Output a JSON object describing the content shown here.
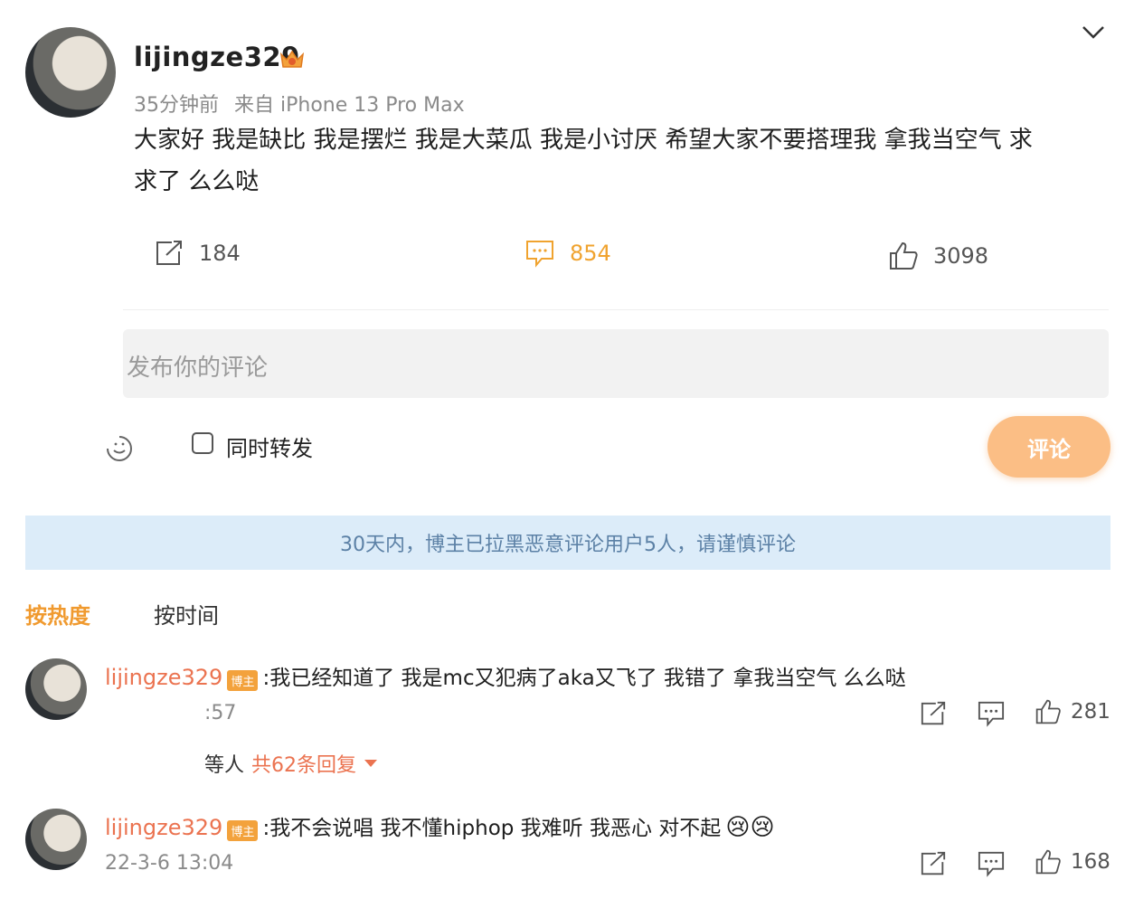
{
  "post": {
    "username": "lijingze329",
    "time": "35分钟前",
    "source": "来自 iPhone 13 Pro Max",
    "text_line1": "大家好 我是缺比 我是摆烂 我是大菜瓜 我是小讨厌 希望大家不要搭理我 拿我当空气 求",
    "text_line2": "求了 么么哒",
    "repost_count": "184",
    "comment_count": "854",
    "like_count": "3098"
  },
  "composer": {
    "placeholder": "发布你的评论",
    "repost_label": "同时转发",
    "submit_label": "评论"
  },
  "notice": "30天内，博主已拉黑恶意评论用户5人，请谨慎评论",
  "sort_tabs": {
    "hot": "按热度",
    "time": "按时间"
  },
  "comments": [
    {
      "username": "lijingze329",
      "badge": "博主",
      "text": ":我已经知道了 我是mc又犯病了aka又飞了 我错了 拿我当空气 么么哒",
      "time": ":57",
      "like_count": "281",
      "reply_prefix": "等人",
      "reply_count": "共62条回复"
    },
    {
      "username": "lijingze329",
      "badge": "博主",
      "text": ":我不会说唱 我不懂hiphop 我难听 我恶心 对不起",
      "emoji": "😢😢",
      "time": "22-3-6 13:04",
      "like_count": "168"
    }
  ],
  "colors": {
    "accent": "#f09a2f",
    "link": "#eb7350",
    "button": "#fbbe85",
    "notice_bg": "#dcecf9"
  }
}
